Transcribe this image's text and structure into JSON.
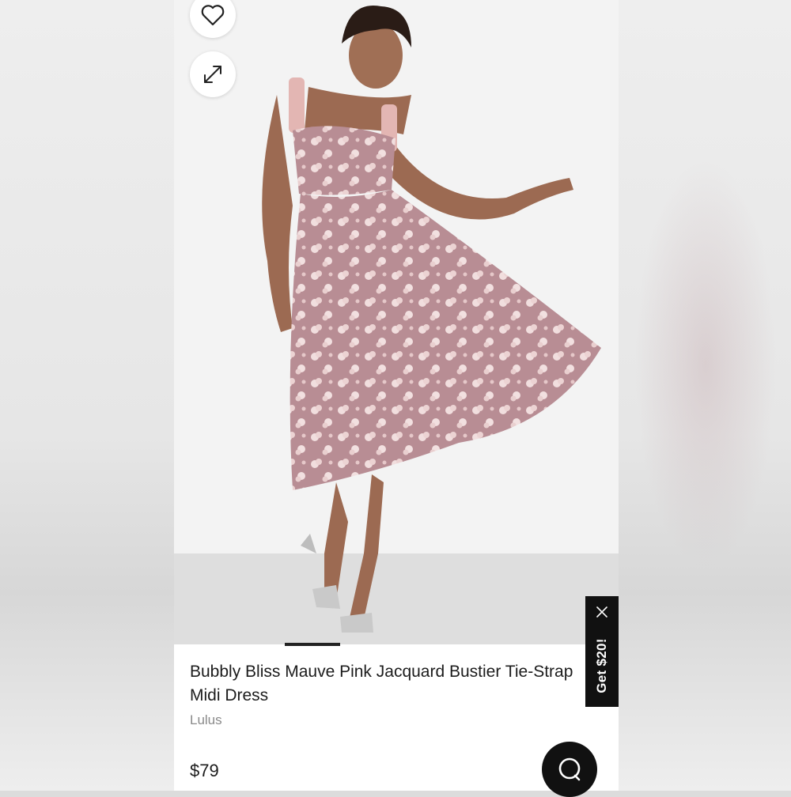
{
  "product": {
    "title": "Bubbly Bliss Mauve Pink Jacquard Bustier Tie-Strap Midi Dress",
    "brand": "Lulus",
    "price": "$79"
  },
  "promo": {
    "label": "Get $20!"
  },
  "icons": {
    "favorite": "heart-icon",
    "expand": "expand-icon",
    "close": "close-icon",
    "chat": "chat-bubble-icon"
  },
  "colors": {
    "dress": "#b88d94",
    "promo_bg": "#111111",
    "chat_bg": "#111111"
  }
}
